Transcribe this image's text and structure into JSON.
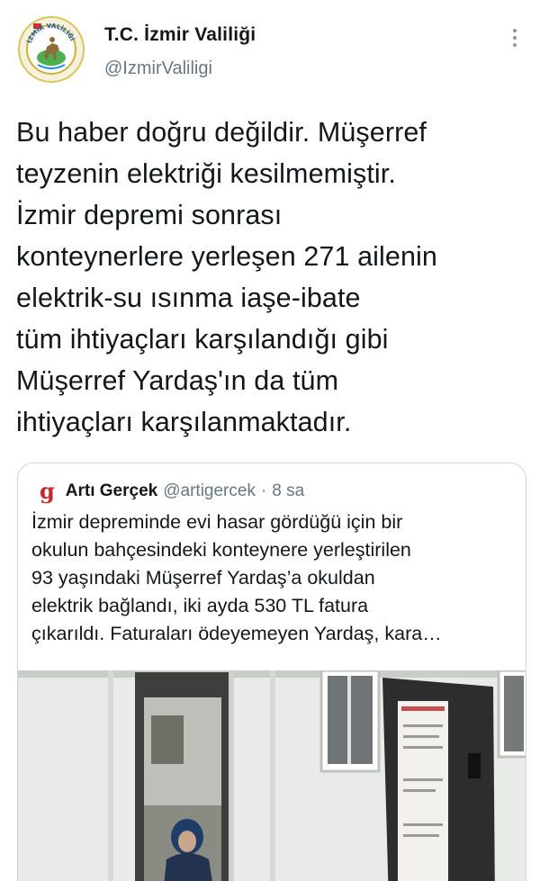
{
  "account": {
    "display_name": "T.C. İzmir Valiliği",
    "handle": "@IzmirValiligi",
    "avatar_text": "İZMİR VALİLİĞİ"
  },
  "tweet": {
    "text": "Bu haber doğru değildir. Müşerref\nteyzenin elektriği kesilmemiştir.\nİzmir depremi sonrası\nkonteynerlere yerleşen 271 ailenin\nelektrik-su ısınma iaşe-ibate\ntüm ihtiyaçları karşılandığı gibi\nMüşerref Yardaş'ın da tüm\nihtiyaçları karşılanmaktadır."
  },
  "quote": {
    "logo": "g",
    "name": "Artı Gerçek",
    "handle": "@artigercek",
    "separator": "·",
    "time": "8 sa",
    "text": "İzmir depreminde evi hasar gördüğü için bir\nokulun bahçesindeki konteynere yerleştirilen\n93 yaşındaki Müşerref Yardaş’a okuldan\nelektrik bağlandı, iki ayda 530 TL fatura\nçıkarıldı. Faturaları ödeyemeyen Yardaş, kara…"
  },
  "icons": {
    "more": "more-vertical-icon",
    "logo": "artigercek-logo-icon"
  },
  "colors": {
    "text_primary": "#14171a",
    "text_secondary": "#657786",
    "border": "#ccd6dd",
    "quote_logo": "#c62828"
  }
}
